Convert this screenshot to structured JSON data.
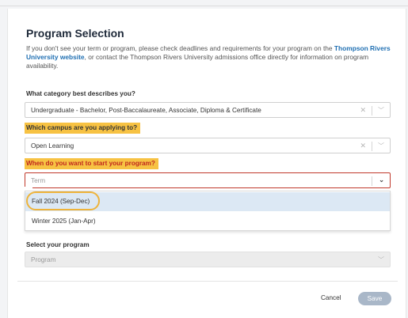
{
  "form": {
    "title": "Program Selection",
    "intro_before": "If you don't see your term or program, please check deadlines and requirements for your program on the ",
    "intro_link": "Thompson Rivers University website",
    "intro_after": ", or contact the Thompson Rivers University admissions office directly for information on program availability."
  },
  "category": {
    "label": "What category best describes you?",
    "value": "Undergraduate - Bachelor, Post-Baccalaureate, Associate, Diploma & Certificate"
  },
  "campus": {
    "label": "Which campus are you applying to?",
    "value": "Open Learning"
  },
  "term": {
    "label": "When do you want to start your program?",
    "placeholder": "Term",
    "options": [
      "Fall 2024 (Sep-Dec)",
      "Winter 2025 (Jan-Apr)"
    ]
  },
  "program": {
    "label": "Select your program",
    "placeholder": "Program"
  },
  "footer": {
    "cancel_label": "Cancel",
    "save_label": "Save"
  },
  "icons": {
    "clear": "close-icon",
    "dropdown": "chevron-down-icon"
  },
  "colors": {
    "highlight": "#f7c243",
    "highlight_ring": "#eeb33a",
    "link": "#1f6fb2",
    "error": "#c0392b",
    "option_active": "#dce8f4",
    "save_disabled": "#a9b7c8"
  }
}
